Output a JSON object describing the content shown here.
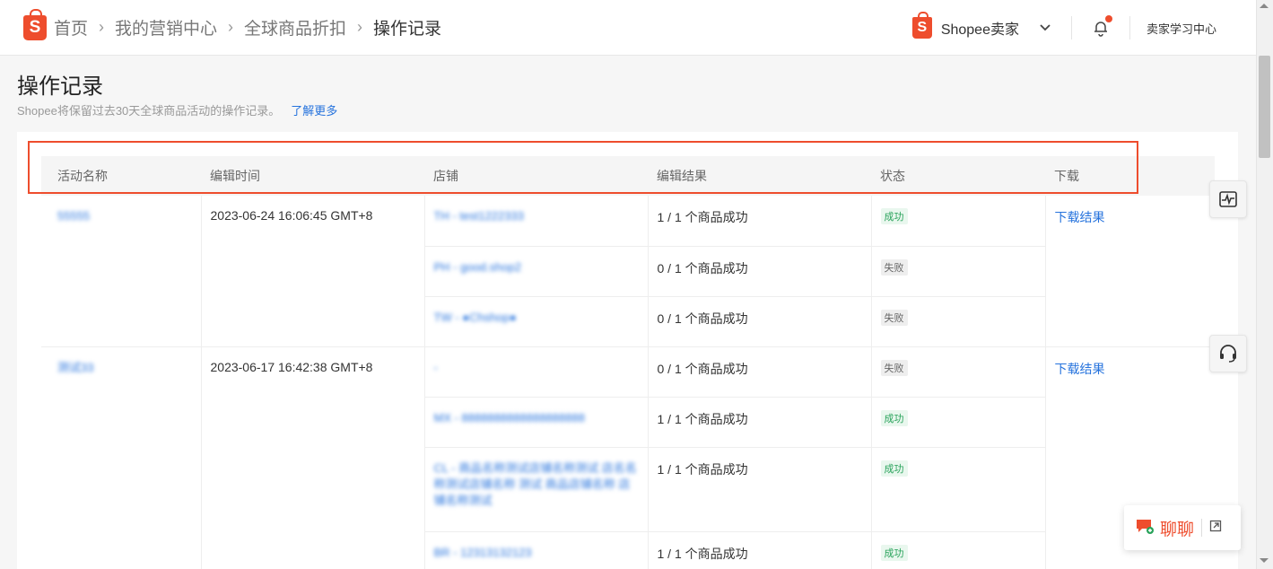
{
  "breadcrumb": {
    "items": [
      "首页",
      "我的营销中心",
      "全球商品折扣"
    ],
    "current": "操作记录"
  },
  "header": {
    "seller_label": "Shopee卖家",
    "learn_center": "卖家学习中心"
  },
  "page": {
    "title": "操作记录",
    "description": "Shopee将保留过去30天全球商品活动的操作记录。",
    "learn_more": "了解更多"
  },
  "table": {
    "headers": [
      "活动名称",
      "编辑时间",
      "店铺",
      "编辑结果",
      "状态",
      "下载"
    ],
    "groups": [
      {
        "name": "55555",
        "time": "2023-06-24 16:06:45 GMT+8",
        "download": "下载结果",
        "rows": [
          {
            "shop": "TH - test1222333",
            "result": "1 / 1 个商品成功",
            "status": "成功",
            "ok": true
          },
          {
            "shop": "PH - good.shop2",
            "result": "0 / 1 个商品成功",
            "status": "失败",
            "ok": false
          },
          {
            "shop": "TW - ●Chshop●",
            "result": "0 / 1 个商品成功",
            "status": "失败",
            "ok": false
          }
        ]
      },
      {
        "name": "测试33",
        "time": "2023-06-17 16:42:38 GMT+8",
        "download": "下载结果",
        "rows": [
          {
            "shop": "-",
            "result": "0 / 1 个商品成功",
            "status": "失败",
            "ok": false
          },
          {
            "shop": "MX - 8888888888888888888",
            "result": "1 / 1 个商品成功",
            "status": "成功",
            "ok": true
          },
          {
            "shop": "CL - 商品名称测试店铺名称测试 店名名称测试店铺名称 测试 商品店铺名称 店铺名称测试",
            "result": "1 / 1 个商品成功",
            "status": "成功",
            "ok": true
          },
          {
            "shop": "BR - 12313132123",
            "result": "1 / 1 个商品成功",
            "status": "成功",
            "ok": true
          }
        ]
      }
    ]
  },
  "chat": {
    "label": "聊聊"
  },
  "icons": {
    "logo": "shopee-bag-icon",
    "seller_logo": "shopee-bag-icon",
    "dropdown": "chevron-down-icon",
    "notification": "bell-icon",
    "float_1": "pulse-monitor-icon",
    "float_2": "headset-icon",
    "chat": "chat-icon",
    "chat_expand": "expand-icon"
  },
  "colors": {
    "brand": "#ee4d2d",
    "link": "#2673dd",
    "success": "#29a35b"
  }
}
